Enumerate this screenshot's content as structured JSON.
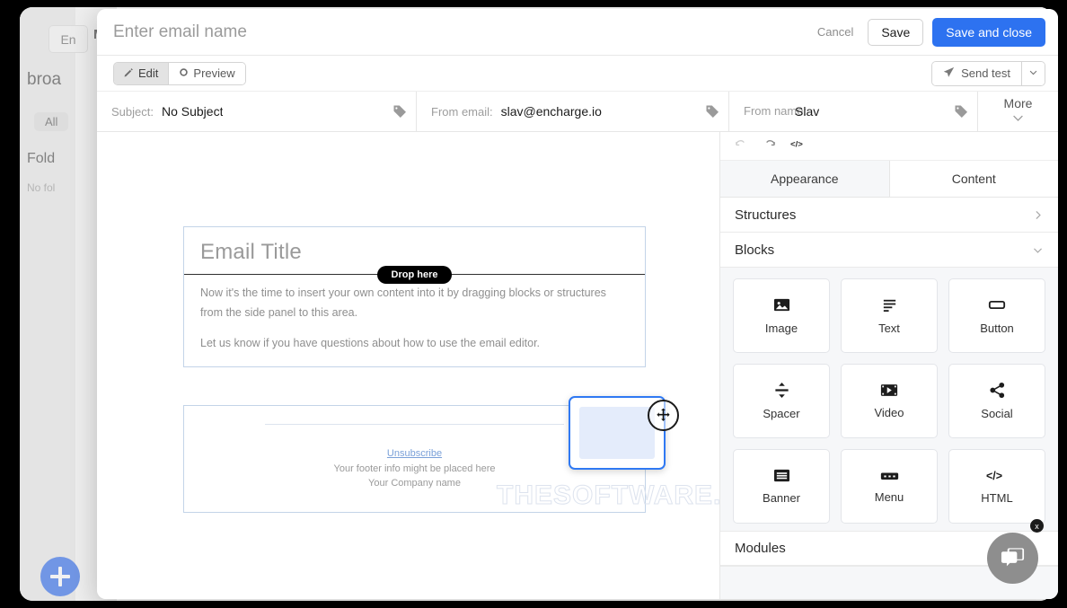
{
  "background_app": {
    "lang_button": "En",
    "tab_label": "My ",
    "nav_heading": "broa",
    "filter_chip": "All",
    "folders_heading": "Fold",
    "folders_empty": "No fol",
    "fab_icon": "plus-icon"
  },
  "modal": {
    "title_bar": {
      "name_value": "",
      "name_placeholder": "Enter email name",
      "cancel_label": "Cancel",
      "save_label": "Save",
      "save_close_label": "Save and close",
      "accent_color": "#2d72f0"
    },
    "toolbar": {
      "edit_label": "Edit",
      "preview_label": "Preview",
      "active_mode": "Edit",
      "send_test_label": "Send test",
      "caret_icon": "chevron-down-icon"
    },
    "meta": {
      "subject_label": "Subject:",
      "subject_value": "No Subject",
      "from_email_label": "From email:",
      "from_email_value": "slav@encharge.io",
      "from_name_label": "From name:",
      "from_name_value": "Slav",
      "more_label": "More",
      "tag_icon": "tag-icon"
    },
    "canvas": {
      "drop_indicator": "Drop here",
      "email_title": "Email Title",
      "paragraph_1": "Now it's the time to insert your own content into it by dragging blocks or structures from the side panel to this area.",
      "paragraph_2": "Let us know if you have questions about how to use the email editor.",
      "footer_link": "Unsubscribe",
      "footer_line_1": "Your footer info might be placed here",
      "footer_line_2": "Your Company name",
      "watermark": "THESOFTWARE.SHOP",
      "drag_cursor_icon": "move-icon"
    },
    "right_panel": {
      "undo_icon": "undo-icon",
      "redo_icon": "redo-icon",
      "code_icon": "code-icon",
      "tabs": [
        {
          "label": "Appearance",
          "active": true
        },
        {
          "label": "Content",
          "active": false
        }
      ],
      "structures_label": "Structures",
      "blocks_label": "Blocks",
      "modules_label": "Modules",
      "blocks": [
        {
          "label": "Image",
          "icon": "image-icon"
        },
        {
          "label": "Text",
          "icon": "text-lines-icon"
        },
        {
          "label": "Button",
          "icon": "button-icon"
        },
        {
          "label": "Spacer",
          "icon": "spacer-icon"
        },
        {
          "label": "Video",
          "icon": "video-icon"
        },
        {
          "label": "Social",
          "icon": "share-icon"
        },
        {
          "label": "Banner",
          "icon": "banner-icon"
        },
        {
          "label": "Menu",
          "icon": "menu-icon"
        },
        {
          "label": "HTML",
          "icon": "code-icon"
        }
      ]
    }
  },
  "chat_widget": {
    "icon": "chat-bubbles-icon",
    "close_label": "x"
  }
}
